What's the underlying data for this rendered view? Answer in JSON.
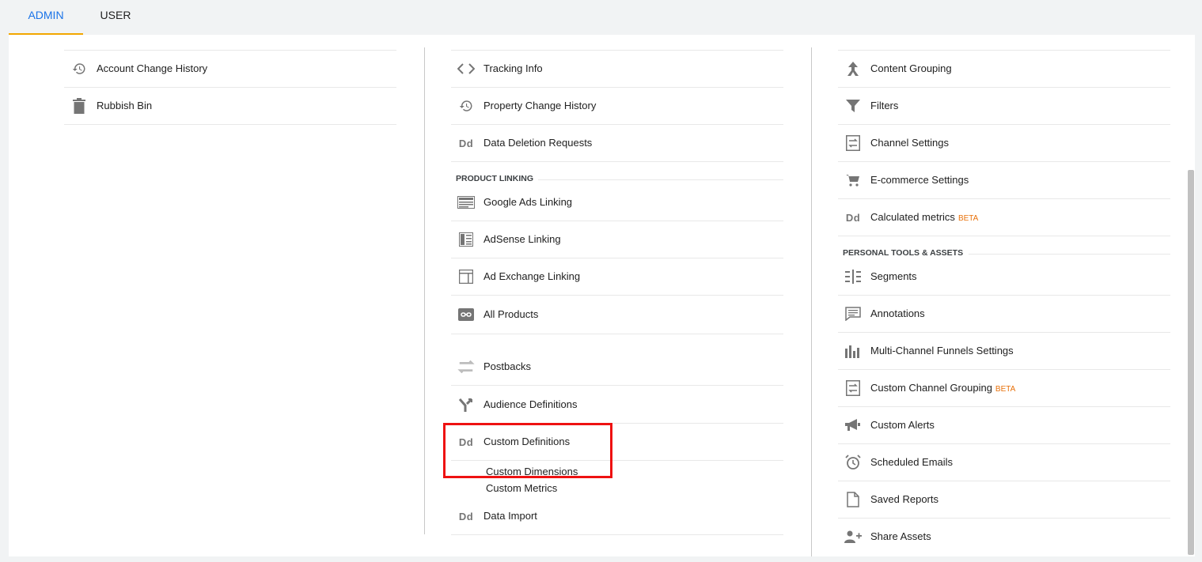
{
  "tabs": {
    "admin": "ADMIN",
    "user": "USER"
  },
  "account_col": {
    "items": [
      {
        "label": "Account Change History"
      },
      {
        "label": "Rubbish Bin"
      }
    ]
  },
  "property_col": {
    "items_top": [
      {
        "label": "Tracking Info",
        "icon_text": "< >"
      },
      {
        "label": "Property Change History"
      },
      {
        "label": "Data Deletion Requests",
        "icon_text": "Dd"
      }
    ],
    "product_linking_heading": "PRODUCT LINKING",
    "linking_items": [
      {
        "label": "Google Ads Linking"
      },
      {
        "label": "AdSense Linking"
      },
      {
        "label": "Ad Exchange Linking"
      },
      {
        "label": "All Products"
      }
    ],
    "items_bottom": [
      {
        "label": "Postbacks"
      },
      {
        "label": "Audience Definitions"
      },
      {
        "label": "Custom Definitions",
        "icon_text": "Dd"
      }
    ],
    "custom_sub": [
      "Custom Dimensions",
      "Custom Metrics"
    ],
    "data_import": {
      "label": "Data Import",
      "icon_text": "Dd"
    }
  },
  "view_col": {
    "items_top": [
      {
        "label": "Content Grouping"
      },
      {
        "label": "Filters"
      },
      {
        "label": "Channel Settings"
      },
      {
        "label": "E-commerce Settings"
      },
      {
        "label": "Calculated metrics",
        "badge": "BETA",
        "icon_text": "Dd"
      }
    ],
    "personal_heading": "PERSONAL TOOLS & ASSETS",
    "personal_items": [
      {
        "label": "Segments"
      },
      {
        "label": "Annotations"
      },
      {
        "label": "Multi-Channel Funnels Settings"
      },
      {
        "label": "Custom Channel Grouping",
        "badge": "BETA"
      },
      {
        "label": "Custom Alerts"
      },
      {
        "label": "Scheduled Emails"
      },
      {
        "label": "Saved Reports"
      },
      {
        "label": "Share Assets"
      }
    ]
  },
  "colors": {
    "accent_tab": "#1a73e8",
    "tab_underline": "#f2a600",
    "highlight": "#ee1111",
    "beta": "#e8710a",
    "icon": "#757575"
  }
}
